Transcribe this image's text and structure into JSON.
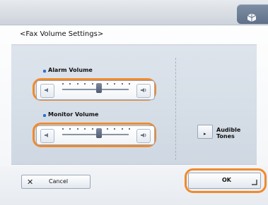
{
  "title": "<Fax Volume Settings>",
  "alarm": {
    "label": "Alarm Volume",
    "value": 0.55,
    "ticks": 10
  },
  "monitor": {
    "label": "Monitor Volume",
    "value": 0.55,
    "ticks": 10
  },
  "audible_tones": {
    "label": "Audible\nTones"
  },
  "buttons": {
    "cancel": "Cancel",
    "ok": "OK"
  },
  "colors": {
    "accent": "#f08a2c",
    "bullet": "#2f6fd1"
  }
}
